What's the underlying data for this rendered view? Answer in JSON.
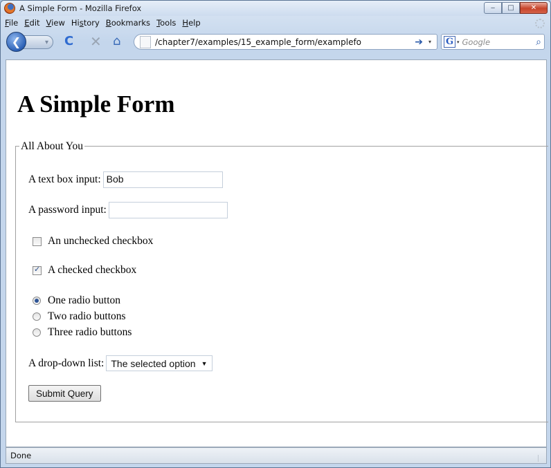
{
  "window": {
    "title": "A Simple Form - Mozilla Firefox",
    "minimize": "‒",
    "maximize": "□",
    "close": "✕"
  },
  "menu": {
    "items": [
      {
        "key": "F",
        "rest": "ile"
      },
      {
        "key": "E",
        "rest": "dit"
      },
      {
        "key": "V",
        "rest": "iew"
      },
      {
        "pre": "Hi",
        "key": "s",
        "rest": "tory"
      },
      {
        "key": "B",
        "rest": "ookmarks"
      },
      {
        "key": "T",
        "rest": "ools"
      },
      {
        "key": "H",
        "rest": "elp"
      }
    ]
  },
  "nav": {
    "back_glyph": "❮",
    "forward_glyph": "▾",
    "reload_glyph": "C",
    "stop_glyph": "✕",
    "home_glyph": "⌂",
    "url": "/chapter7/examples/15_example_form/examplefo",
    "go_glyph": "➔",
    "url_drop_glyph": "▾",
    "search_engine_glyph": "G",
    "search_drop_glyph": "▾",
    "search_placeholder": "Google",
    "search_glyph": "⌕"
  },
  "page": {
    "heading": "A Simple Form",
    "fieldset_legend": "All About You",
    "text_label": "A text box input:",
    "text_value": "Bob",
    "password_label": "A password input:",
    "password_value": "",
    "checkbox_unchecked_label": "An unchecked checkbox",
    "checkbox_checked_label": "A checked checkbox",
    "radios": [
      {
        "label": "One radio button",
        "checked": true
      },
      {
        "label": "Two radio buttons",
        "checked": false
      },
      {
        "label": "Three radio buttons",
        "checked": false
      }
    ],
    "select_label": "A drop-down list:",
    "select_value": "The selected option",
    "select_arrow": "▼",
    "submit_label": "Submit Query"
  },
  "status": {
    "text": "Done"
  }
}
